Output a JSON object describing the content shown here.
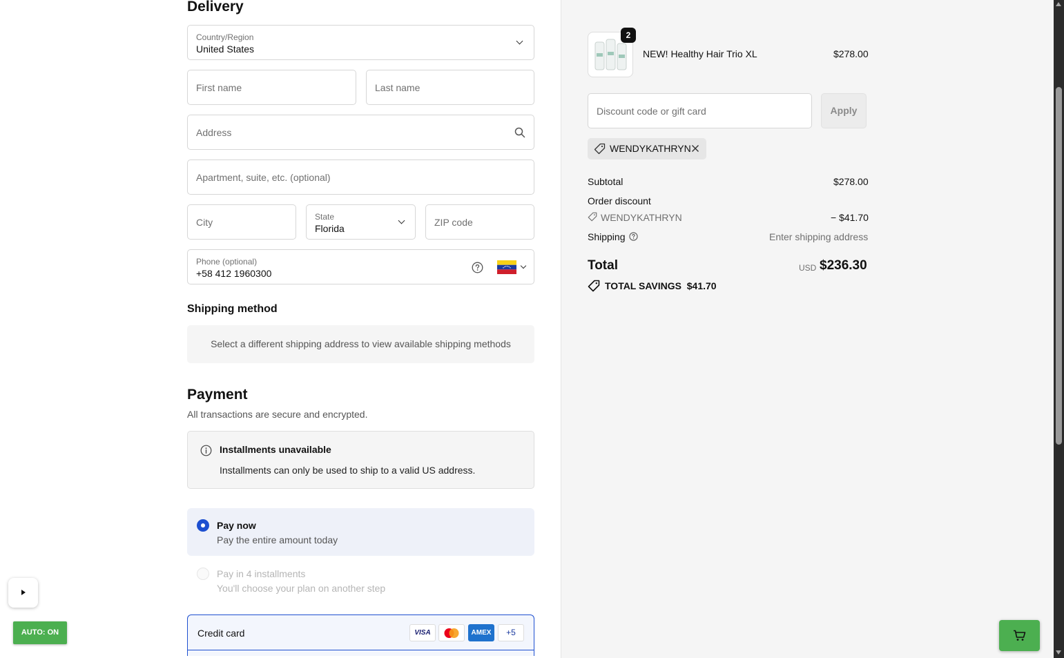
{
  "delivery": {
    "heading": "Delivery",
    "country": {
      "label": "Country/Region",
      "value": "United States"
    },
    "first_name": {
      "placeholder": "First name"
    },
    "last_name": {
      "placeholder": "Last name"
    },
    "address": {
      "placeholder": "Address"
    },
    "apartment": {
      "placeholder": "Apartment, suite, etc. (optional)"
    },
    "city": {
      "placeholder": "City"
    },
    "state": {
      "label": "State",
      "value": "Florida"
    },
    "zip": {
      "placeholder": "ZIP code"
    },
    "phone": {
      "label": "Phone (optional)",
      "value": "+58 412 1960300",
      "flag": "venezuela-flag"
    }
  },
  "shipping_method": {
    "heading": "Shipping method",
    "message": "Select a different shipping address to view available shipping methods"
  },
  "payment": {
    "heading": "Payment",
    "subtitle": "All transactions are secure and encrypted.",
    "notice": {
      "title": "Installments unavailable",
      "body": "Installments can only be used to ship to a valid US address."
    },
    "options": [
      {
        "title": "Pay now",
        "subtitle": "Pay the entire amount today",
        "selected": true
      },
      {
        "title": "Pay in 4 installments",
        "subtitle": "You'll choose your plan on another step",
        "selected": false
      }
    ],
    "credit_card": {
      "label": "Credit card",
      "brands": [
        "VISA",
        "",
        "AMEX"
      ],
      "more": "+5"
    }
  },
  "overlay": {
    "auto_label": "AUTO: ON"
  },
  "summary": {
    "product": {
      "name": "NEW! Healthy Hair Trio XL",
      "price": "$278.00",
      "quantity": "2"
    },
    "discount": {
      "placeholder": "Discount code or gift card",
      "apply_label": "Apply",
      "applied_code": "WENDYKATHRYN"
    },
    "subtotal": {
      "label": "Subtotal",
      "value": "$278.00"
    },
    "order_discount": {
      "label": "Order discount",
      "code": "WENDYKATHRYN",
      "value": "− $41.70"
    },
    "shipping": {
      "label": "Shipping",
      "value": "Enter shipping address"
    },
    "total": {
      "label": "Total",
      "currency": "USD",
      "value": "$236.30"
    },
    "savings": {
      "label": "TOTAL SAVINGS",
      "value": "$41.70"
    }
  },
  "colors": {
    "accent": "#1d4fd0",
    "green": "#4caf50"
  }
}
